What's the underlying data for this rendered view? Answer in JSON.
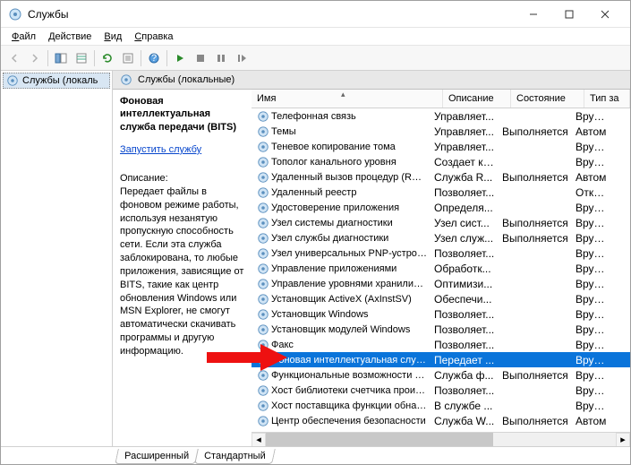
{
  "window": {
    "title": "Службы"
  },
  "menu": {
    "file": "Файл",
    "action": "Действие",
    "view": "Вид",
    "help": "Справка"
  },
  "tree": {
    "root": "Службы (локаль"
  },
  "rpane_title": "Службы (локальные)",
  "detail": {
    "title": "Фоновая интеллектуальная служба передачи (BITS)",
    "start_link": "Запустить",
    "start_suffix": " службу",
    "sub": "Описание:",
    "desc": "Передает файлы в фоновом режиме работы, используя незанятую пропускную способность сети. Если эта служба заблокирована, то любые приложения, зависящие от BITS, такие как центр обновления Windows или MSN Explorer, не смогут автоматически скачивать программы и другую информацию."
  },
  "columns": {
    "name": "Имя",
    "desc": "Описание",
    "state": "Состояние",
    "type": "Тип за"
  },
  "services": [
    {
      "name": "Телефонная связь",
      "desc": "Управляет...",
      "state": "",
      "type": "Вручну"
    },
    {
      "name": "Темы",
      "desc": "Управляет...",
      "state": "Выполняется",
      "type": "Автом"
    },
    {
      "name": "Теневое копирование тома",
      "desc": "Управляет...",
      "state": "",
      "type": "Вручну"
    },
    {
      "name": "Тополог канального уровня",
      "desc": "Создает ка...",
      "state": "",
      "type": "Вручну"
    },
    {
      "name": "Удаленный вызов процедур (RPC)",
      "desc": "Служба R...",
      "state": "Выполняется",
      "type": "Автом"
    },
    {
      "name": "Удаленный реестр",
      "desc": "Позволяет...",
      "state": "",
      "type": "Отклю"
    },
    {
      "name": "Удостоверение приложения",
      "desc": "Определя...",
      "state": "",
      "type": "Вручну"
    },
    {
      "name": "Узел системы диагностики",
      "desc": "Узел сист...",
      "state": "Выполняется",
      "type": "Вручну"
    },
    {
      "name": "Узел службы диагностики",
      "desc": "Узел служ...",
      "state": "Выполняется",
      "type": "Вручну"
    },
    {
      "name": "Узел универсальных PNP-устройств",
      "desc": "Позволяет...",
      "state": "",
      "type": "Вручну"
    },
    {
      "name": "Управление приложениями",
      "desc": "Обработк...",
      "state": "",
      "type": "Вручну"
    },
    {
      "name": "Управление уровнями хранилища",
      "desc": "Оптимизи...",
      "state": "",
      "type": "Вручну"
    },
    {
      "name": "Установщик ActiveX (AxInstSV)",
      "desc": "Обеспечи...",
      "state": "",
      "type": "Вручну"
    },
    {
      "name": "Установщик Windows",
      "desc": "Позволяет...",
      "state": "",
      "type": "Вручну"
    },
    {
      "name": "Установщик модулей Windows",
      "desc": "Позволяет...",
      "state": "",
      "type": "Вручну"
    },
    {
      "name": "Факс",
      "desc": "Позволяет...",
      "state": "",
      "type": "Вручну"
    },
    {
      "name": "Фоновая интеллектуальная служба ...",
      "desc": "Передает ...",
      "state": "",
      "type": "Вручну",
      "selected": true
    },
    {
      "name": "Функциональные возможности для ...",
      "desc": "Служба ф...",
      "state": "Выполняется",
      "type": "Вручну"
    },
    {
      "name": "Хост библиотеки счетчика произво...",
      "desc": "Позволяет...",
      "state": "",
      "type": "Вручну"
    },
    {
      "name": "Хост поставщика функции обнаруж...",
      "desc": "В службе ...",
      "state": "",
      "type": "Вручну"
    },
    {
      "name": "Центр обеспечения безопасности",
      "desc": "Служба W...",
      "state": "Выполняется",
      "type": "Автом"
    }
  ],
  "tabs": {
    "ext": "Расширенный",
    "std": "Стандартный"
  }
}
